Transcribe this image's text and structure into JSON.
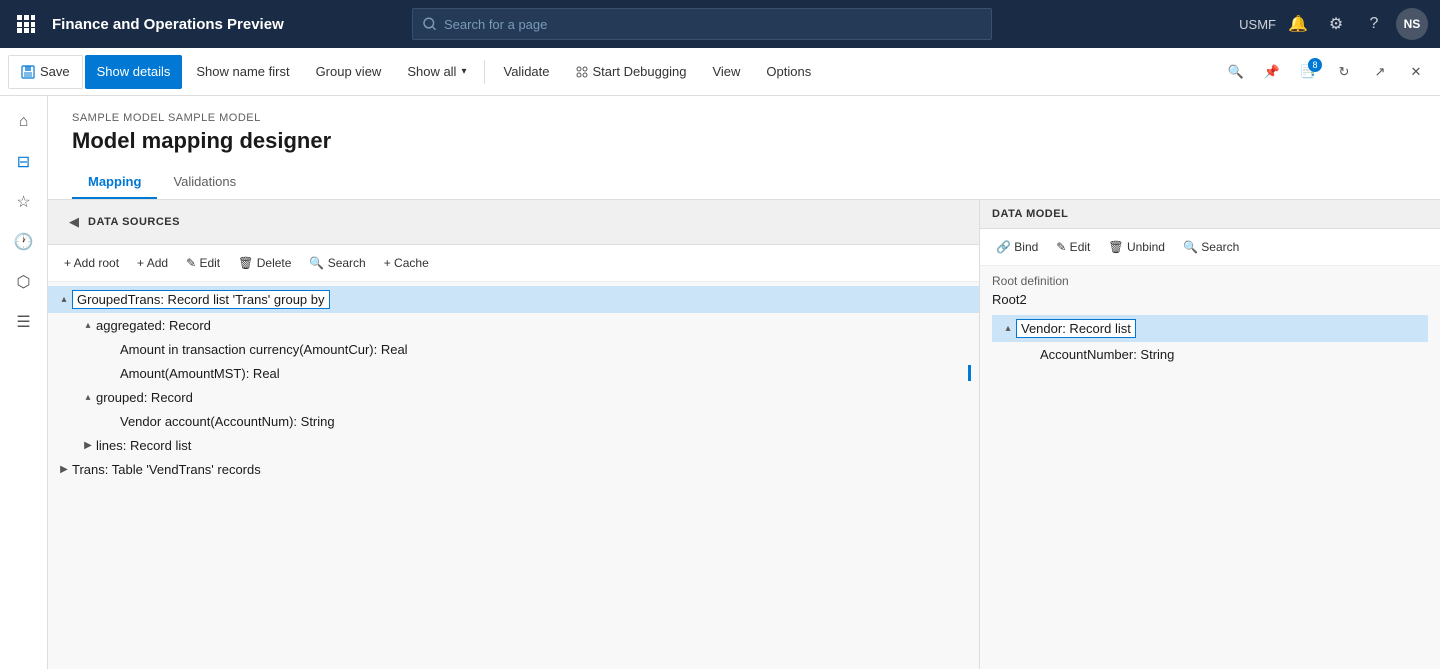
{
  "app": {
    "title": "Finance and Operations Preview",
    "search_placeholder": "Search for a page",
    "user": "USMF",
    "avatar": "NS"
  },
  "toolbar": {
    "save_label": "Save",
    "show_details_label": "Show details",
    "show_name_label": "Show name first",
    "group_view_label": "Group view",
    "show_all_label": "Show all",
    "validate_label": "Validate",
    "start_debugging_label": "Start Debugging",
    "view_label": "View",
    "options_label": "Options"
  },
  "page": {
    "breadcrumb": "SAMPLE MODEL SAMPLE MODEL",
    "title": "Model mapping designer",
    "tabs": [
      {
        "label": "Mapping",
        "active": true
      },
      {
        "label": "Validations",
        "active": false
      }
    ]
  },
  "data_sources": {
    "section_title": "DATA SOURCES",
    "toolbar_items": [
      {
        "label": "+ Add root",
        "icon": ""
      },
      {
        "label": "+ Add",
        "icon": ""
      },
      {
        "label": "✎ Edit",
        "icon": ""
      },
      {
        "label": "🗑 Delete",
        "icon": ""
      },
      {
        "label": "🔍 Search",
        "icon": ""
      },
      {
        "label": "+ Cache",
        "icon": ""
      }
    ],
    "tree": [
      {
        "id": "grouped-trans",
        "label": "GroupedTrans: Record list 'Trans' group by",
        "indent": 0,
        "expanded": true,
        "selected": true,
        "toggle": "▴",
        "children": [
          {
            "id": "aggregated",
            "label": "aggregated: Record",
            "indent": 1,
            "expanded": true,
            "toggle": "▴",
            "children": [
              {
                "id": "amount-cur",
                "label": "Amount in transaction currency(AmountCur): Real",
                "indent": 2,
                "expanded": false,
                "toggle": ""
              },
              {
                "id": "amount-mst",
                "label": "Amount(AmountMST): Real",
                "indent": 2,
                "expanded": false,
                "toggle": "",
                "has_indicator": true
              }
            ]
          },
          {
            "id": "grouped",
            "label": "grouped: Record",
            "indent": 1,
            "expanded": true,
            "toggle": "▴",
            "children": [
              {
                "id": "vendor-account",
                "label": "Vendor account(AccountNum): String",
                "indent": 2,
                "expanded": false,
                "toggle": ""
              }
            ]
          },
          {
            "id": "lines",
            "label": "lines: Record list",
            "indent": 1,
            "expanded": false,
            "toggle": "▶"
          }
        ]
      },
      {
        "id": "trans",
        "label": "Trans: Table 'VendTrans' records",
        "indent": 0,
        "expanded": false,
        "toggle": "▶"
      }
    ]
  },
  "data_model": {
    "section_title": "DATA MODEL",
    "toolbar_items": [
      {
        "label": "Bind",
        "icon": "🔗"
      },
      {
        "label": "Edit",
        "icon": "✎"
      },
      {
        "label": "Unbind",
        "icon": "🗑"
      },
      {
        "label": "Search",
        "icon": "🔍"
      }
    ],
    "root_definition_label": "Root definition",
    "root_value": "Root2",
    "tree": [
      {
        "id": "vendor",
        "label": "Vendor: Record list",
        "indent": 0,
        "expanded": true,
        "selected": true,
        "toggle": "▴",
        "children": [
          {
            "id": "account-number",
            "label": "AccountNumber: String",
            "indent": 1,
            "expanded": false,
            "toggle": ""
          }
        ]
      }
    ]
  }
}
